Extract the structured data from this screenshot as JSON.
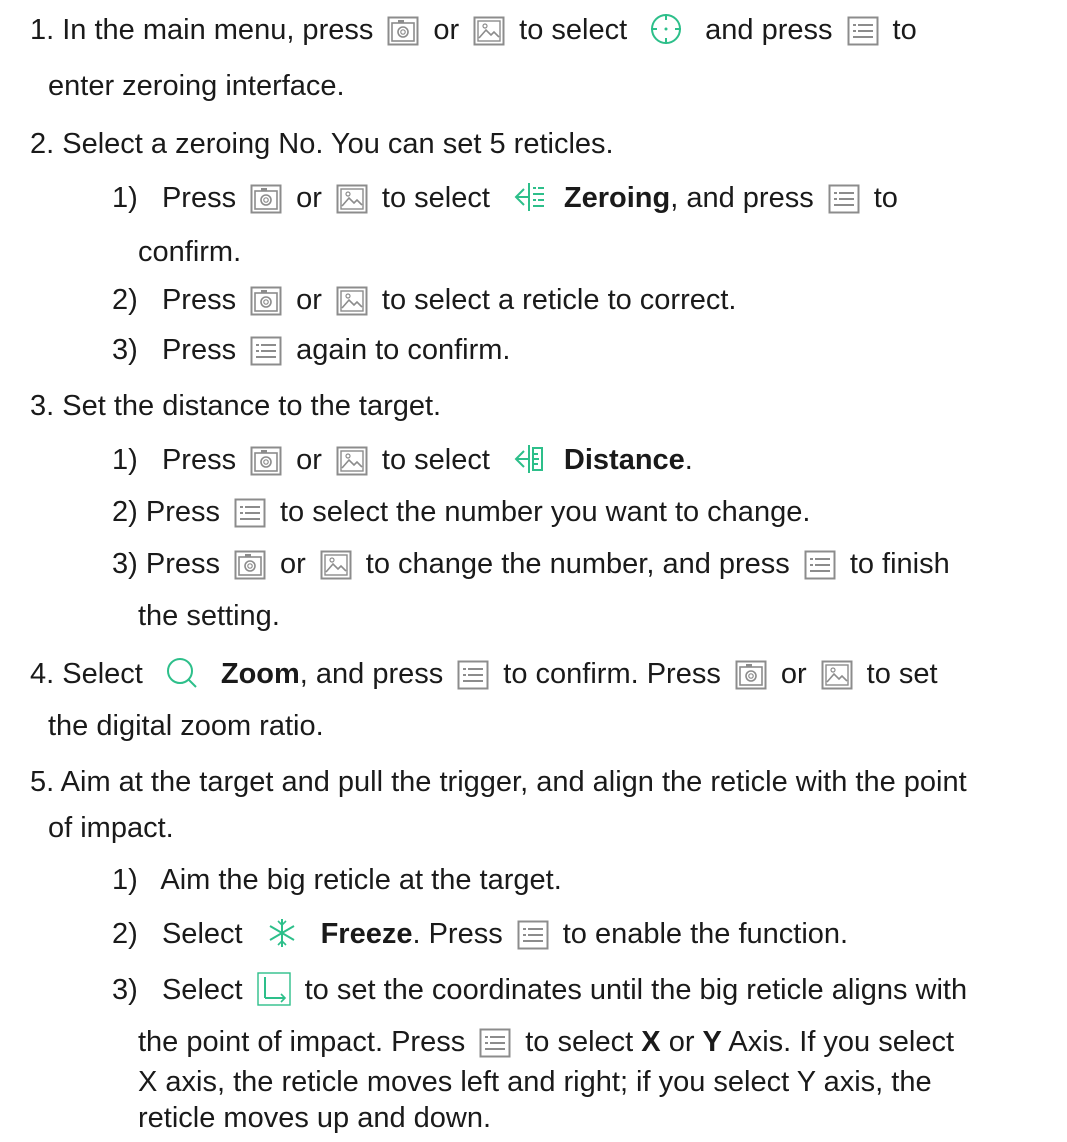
{
  "steps": [
    {
      "num": "1.",
      "l1_a": "In the main menu, press",
      "or": "or",
      "l1_b": "to select",
      "l1_c": "and press",
      "l1_d": "to",
      "l2": "enter zeroing interface."
    },
    {
      "num": "2.",
      "l1": "Select a zeroing No. You can set 5 reticles.",
      "sub": [
        {
          "num": "1)",
          "press": "Press",
          "or": "or",
          "to_select": "to select",
          "name": "Zeroing",
          "rest": ", and press",
          "to": "to",
          "cont": "confirm."
        },
        {
          "num": "2)",
          "press": "Press",
          "or": "or",
          "rest": "to select a reticle to correct."
        },
        {
          "num": "3)",
          "press": "Press",
          "rest": "again to confirm."
        }
      ]
    },
    {
      "num": "3.",
      "l1": "Set the distance to the target.",
      "sub": [
        {
          "num": "1)",
          "press": "Press",
          "or": "or",
          "to_select": "to select",
          "name": "Distance",
          "end": "."
        },
        {
          "num": "2)",
          "press": "Press",
          "rest": "to select the number you want to change."
        },
        {
          "num": "3)",
          "press": "Press",
          "or": "or",
          "rest": "to change the number, and press",
          "end": "to finish",
          "cont": "the setting."
        }
      ]
    },
    {
      "num": "4.",
      "select": "Select",
      "name": "Zoom",
      "rest1": ", and press",
      "rest2": "to confirm. Press",
      "or": "or",
      "end": "to set",
      "l2": "the digital zoom ratio."
    },
    {
      "num": "5.",
      "l1": "Aim at the target and pull the trigger, and align the reticle with the point",
      "l2": "of impact.",
      "sub": [
        {
          "num": "1)",
          "text": "Aim the big reticle at the target."
        },
        {
          "num": "2)",
          "select": "Select",
          "name": "Freeze",
          "rest1": ". Press",
          "rest2": "to enable the function."
        },
        {
          "num": "3)",
          "select": "Select",
          "rest": "to set the coordinates until the big reticle aligns with",
          "l2_a": "the point of impact. Press",
          "l2_b": "to select",
          "x": "X",
          "or": "or",
          "y": "Y",
          "l2_c": "Axis. If you select",
          "l3": "X axis, the reticle moves left and right; if you select Y axis, the",
          "l4": "reticle moves up and down."
        }
      ]
    }
  ],
  "icons": {
    "camera": "camera-icon",
    "gallery": "gallery-icon",
    "menu": "menu-icon",
    "crosshair": "crosshair-icon",
    "zeroing": "zeroing-icon",
    "distance": "distance-icon",
    "zoom": "zoom-icon",
    "freeze": "freeze-icon",
    "coordinates": "coordinates-icon"
  },
  "colors": {
    "accent": "#2dbf8a",
    "text": "#1a1a1a",
    "icon_gray": "#8c8c8c"
  }
}
